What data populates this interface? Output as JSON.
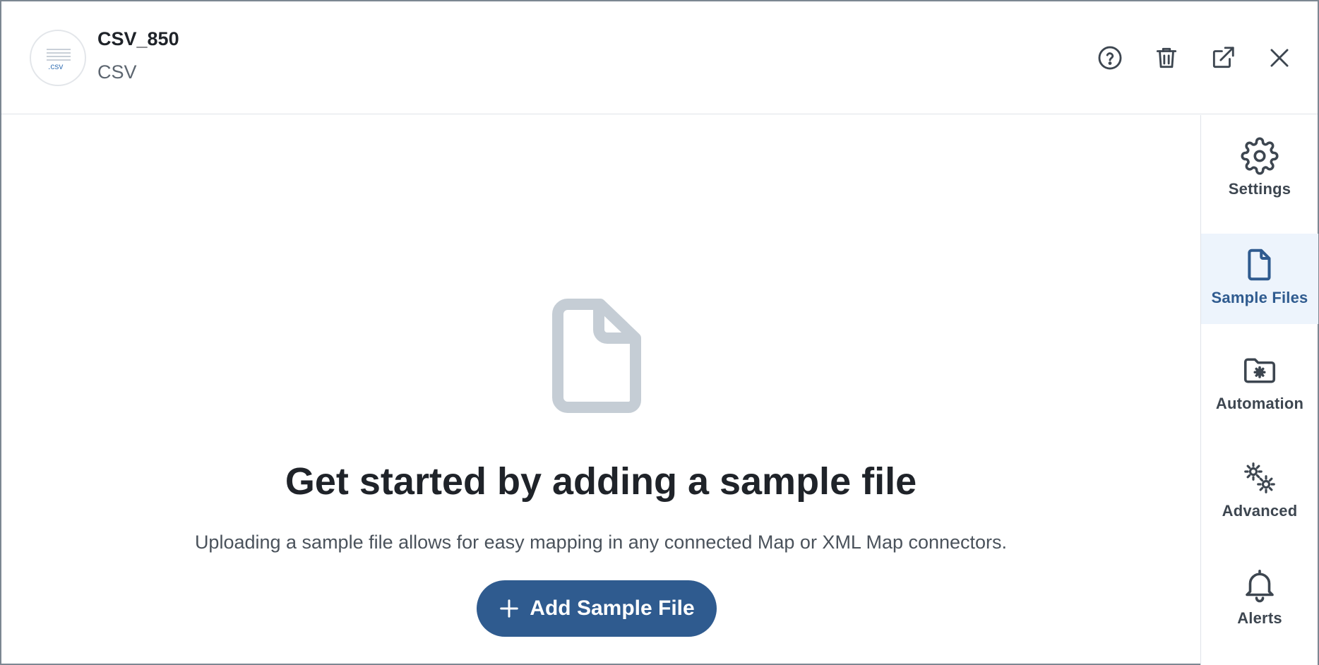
{
  "header": {
    "logo_ext": ".csv",
    "title": "CSV_850",
    "subtitle": "CSV",
    "actions": [
      {
        "name": "help",
        "icon": "help-circle-icon"
      },
      {
        "name": "delete",
        "icon": "trash-icon"
      },
      {
        "name": "open-external",
        "icon": "external-link-icon"
      },
      {
        "name": "close",
        "icon": "close-icon"
      }
    ]
  },
  "sidebar": {
    "items": [
      {
        "label": "Settings",
        "icon": "gear-icon",
        "active": false
      },
      {
        "label": "Sample Files",
        "icon": "file-icon",
        "active": true
      },
      {
        "label": "Automation",
        "icon": "folder-gear-icon",
        "active": false
      },
      {
        "label": "Advanced",
        "icon": "gears-icon",
        "active": false
      },
      {
        "label": "Alerts",
        "icon": "bell-icon",
        "active": false
      }
    ]
  },
  "main": {
    "illustration": "file-icon",
    "headline": "Get started by adding a sample file",
    "description": "Uploading a sample file allows for easy mapping in any connected Map or XML Map connectors.",
    "add_button_label": "Add Sample File"
  },
  "colors": {
    "accent": "#2f5b8f",
    "active_bg": "#edf4fc",
    "illustration": "#c5cdd5",
    "text_dark": "#1f2329"
  }
}
